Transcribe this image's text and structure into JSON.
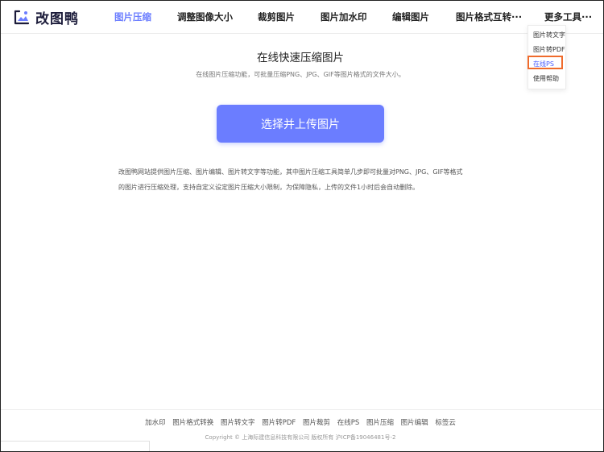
{
  "brand": {
    "name": "改图鸭"
  },
  "nav": {
    "items": [
      {
        "label": "图片压缩",
        "active": true
      },
      {
        "label": "调整图像大小"
      },
      {
        "label": "裁剪图片"
      },
      {
        "label": "图片加水印"
      },
      {
        "label": "编辑图片"
      },
      {
        "label": "图片格式互转···"
      },
      {
        "label": "更多工具···"
      }
    ]
  },
  "dropdown": {
    "items": [
      {
        "label": "图片转文字"
      },
      {
        "label": "图片转PDF"
      },
      {
        "label": "在线PS",
        "selected": true
      },
      {
        "label": "使用帮助"
      }
    ]
  },
  "main": {
    "title": "在线快速压缩图片",
    "subtitle": "在线图片压缩功能，可批量压缩PNG、JPG、GIF等图片格式的文件大小。",
    "upload_label": "选择并上传图片",
    "desc_line1": "改图鸭网站提供图片压缩、图片编辑、图片转文字等功能，其中图片压缩工具简单几步即可批量对PNG、JPG、GIF等格式",
    "desc_line2": "的图片进行压缩处理，支持自定义设定图片压缩大小限制，为保障隐私，上传的文件1小时后会自动删除。"
  },
  "footer": {
    "links": [
      "加水印",
      "图片格式转换",
      "图片转文字",
      "图片转PDF",
      "图片裁剪",
      "在线PS",
      "图片压缩",
      "图片编辑",
      "标签云"
    ],
    "copyright": "Copyright © 上海际建信息科技有限公司 版权所有 沪ICP备19046481号-2"
  },
  "colors": {
    "accent": "#6b7dff",
    "highlight_box": "#ef6b2c",
    "selected_link": "#4a5cff"
  }
}
